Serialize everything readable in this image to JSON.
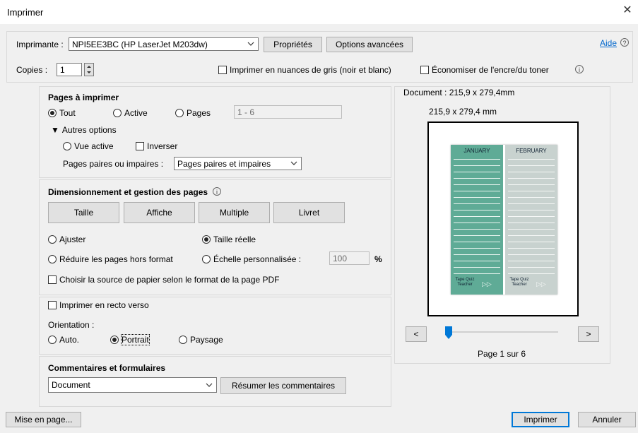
{
  "window": {
    "title": "Imprimer"
  },
  "printer": {
    "label": "Imprimante :",
    "selected": "NPI5EE3BC (HP LaserJet M203dw)",
    "properties_button": "Propriétés",
    "advanced_button": "Options avancées",
    "help_link": "Aide",
    "copies_label": "Copies :",
    "copies_value": "1",
    "grayscale_label": "Imprimer en nuances de gris (noir et blanc)",
    "save_ink_label": "Économiser de l'encre/du toner"
  },
  "pages": {
    "heading": "Pages à imprimer",
    "all": "Tout",
    "active": "Active",
    "pages": "Pages",
    "range_placeholder": "1 - 6",
    "more_options": "Autres options",
    "active_view": "Vue active",
    "reverse": "Inverser",
    "odd_even_label": "Pages paires ou impaires :",
    "odd_even_selected": "Pages paires et impaires"
  },
  "sizing": {
    "heading": "Dimensionnement et gestion des pages",
    "tabs": [
      "Taille",
      "Affiche",
      "Multiple",
      "Livret"
    ],
    "fit": "Ajuster",
    "actual_size": "Taille réelle",
    "shrink": "Réduire les pages hors format",
    "custom_scale": "Échelle personnalisée :",
    "scale_value": "100",
    "percent": "%",
    "paper_source": "Choisir la source de papier selon le format de la page PDF"
  },
  "duplex": {
    "label": "Imprimer en recto verso",
    "orientation_label": "Orientation :",
    "auto": "Auto.",
    "portrait": "Portrait",
    "landscape": "Paysage"
  },
  "comments": {
    "heading": "Commentaires et formulaires",
    "selected": "Document",
    "summarize_button": "Résumer les commentaires"
  },
  "preview": {
    "document_size": "Document : 215,9 x 279,4mm",
    "page_size": "215,9 x 279,4 mm",
    "prev": "<",
    "next": ">",
    "page_indicator": "Page 1 sur 6",
    "thumb": {
      "left_title": "JANUARY",
      "right_title": "FEBRUARY",
      "left_footer": "Tape Quiz Teacher",
      "right_footer": "Tape Quiz Teacher"
    },
    "colors": {
      "left_panel": "#5fab96",
      "right_panel": "#c8d2cf",
      "accent": "#0078d7"
    }
  },
  "footer": {
    "page_setup": "Mise en page...",
    "print": "Imprimer",
    "cancel": "Annuler"
  }
}
